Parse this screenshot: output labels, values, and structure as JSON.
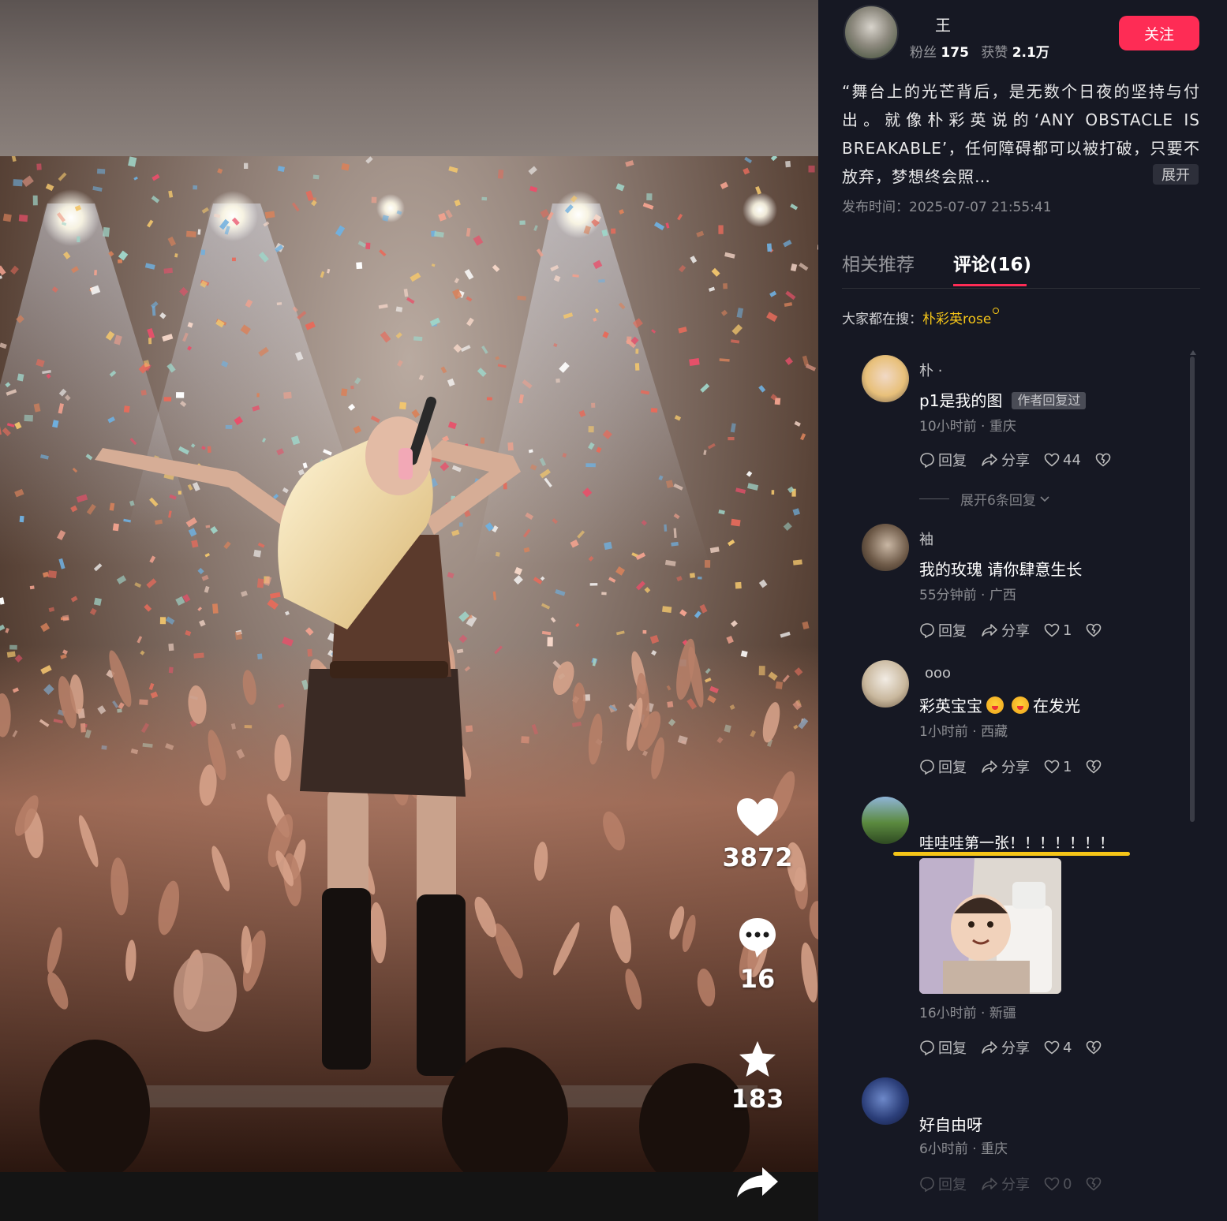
{
  "video": {
    "actions": {
      "likes": "3872",
      "comments": "16",
      "favorites": "183"
    },
    "icons": [
      "heart-icon",
      "comment-icon",
      "star-icon",
      "share-icon"
    ]
  },
  "author": {
    "name": "王",
    "fans_label": "粉丝",
    "fans": "175",
    "likes_label": "获赞",
    "likes": "2.1万",
    "follow_label": "关注"
  },
  "post": {
    "description": "“舞台上的光芒背后，是无数个日夜的坚持与付出。就像朴彩英说的‘ANY OBSTACLE IS BREAKABLE’，任何障碍都可以被打破，只要不放弃，梦想终会照…",
    "expand_label": "展开",
    "publish_time": "发布时间：2025-07-07 21:55:41"
  },
  "tabs": {
    "related": "相关推荐",
    "comments": "评论(16)"
  },
  "search_hint": {
    "label": "大家都在搜：",
    "keyword": "朴彩英rose"
  },
  "comment_actions": {
    "reply": "回复",
    "share": "分享"
  },
  "comments": [
    {
      "name": "朴 ·",
      "text": "p1是我的图",
      "badge": "作者回复过",
      "meta": "10小时前 · 重庆",
      "likes": "44",
      "expand_replies": "展开6条回复"
    },
    {
      "name": "袖",
      "text": "我的玫瑰 请你肆意生长",
      "meta": "55分钟前 · 广西",
      "likes": "1"
    },
    {
      "name": "ooo",
      "text_before": "彩英宝宝",
      "text_after": "在发光",
      "meta": "1小时前 · 西藏",
      "likes": "1"
    },
    {
      "name": "",
      "text": "哇哇哇第一张！！！！！！！",
      "meta": "16小时前 · 新疆",
      "likes": "4"
    },
    {
      "name": "",
      "text": "好自由呀",
      "meta": "6小时前 · 重庆",
      "likes": "0"
    }
  ],
  "colors": {
    "accent": "#fe2c55",
    "highlight": "#f5c518",
    "panel_bg": "#161823"
  }
}
